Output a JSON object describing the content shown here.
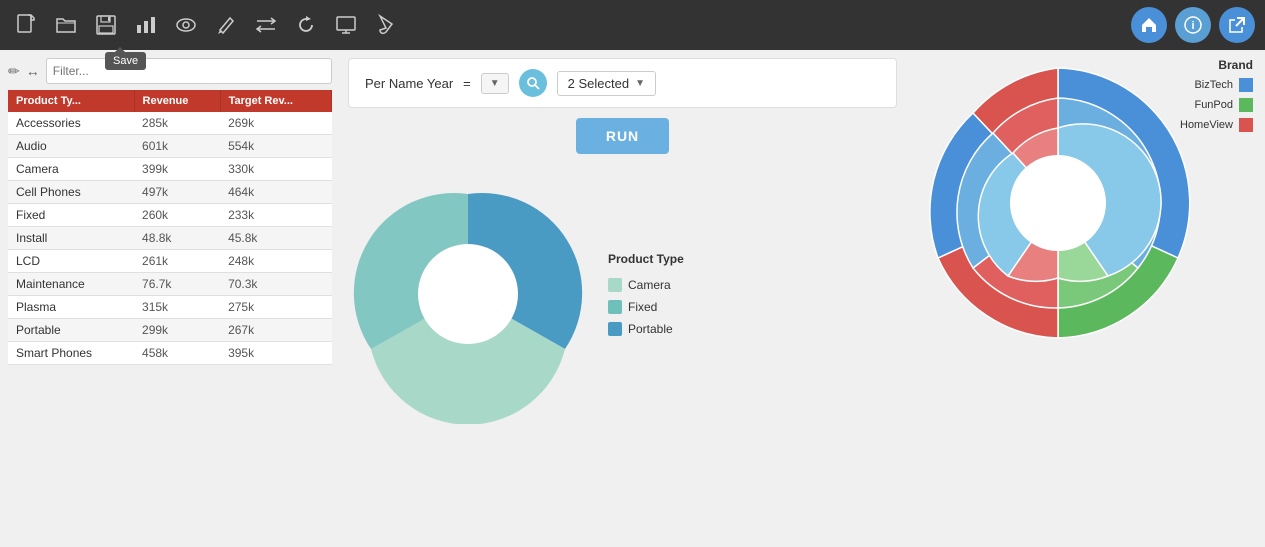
{
  "toolbar": {
    "icons": [
      {
        "name": "new-file-icon",
        "symbol": "🗋",
        "tooltip": ""
      },
      {
        "name": "open-icon",
        "symbol": "📂",
        "tooltip": ""
      },
      {
        "name": "save-icon",
        "symbol": "💾",
        "tooltip": "Save"
      },
      {
        "name": "chart-icon",
        "symbol": "📊",
        "tooltip": ""
      },
      {
        "name": "eye-icon",
        "symbol": "👁",
        "tooltip": ""
      },
      {
        "name": "edit-icon",
        "symbol": "✏",
        "tooltip": ""
      },
      {
        "name": "swap-icon",
        "symbol": "⇄",
        "tooltip": ""
      },
      {
        "name": "refresh-icon",
        "symbol": "🔄",
        "tooltip": ""
      },
      {
        "name": "monitor-icon",
        "symbol": "🖥",
        "tooltip": ""
      },
      {
        "name": "brush-icon",
        "symbol": "🖌",
        "tooltip": ""
      }
    ],
    "save_tooltip": "Save",
    "home_btn": "🏠",
    "info_btn": "ℹ",
    "export_btn": "↗"
  },
  "filter_panel": {
    "filter_placeholder": "Filter...",
    "pencil_icon": "✏",
    "arrow_icon": "↔"
  },
  "table": {
    "headers": [
      "Product Ty...",
      "Revenue",
      "Target Rev..."
    ],
    "rows": [
      [
        "Accessories",
        "285k",
        "269k"
      ],
      [
        "Audio",
        "601k",
        "554k"
      ],
      [
        "Camera",
        "399k",
        "330k"
      ],
      [
        "Cell Phones",
        "497k",
        "464k"
      ],
      [
        "Fixed",
        "260k",
        "233k"
      ],
      [
        "Install",
        "48.8k",
        "45.8k"
      ],
      [
        "LCD",
        "261k",
        "248k"
      ],
      [
        "Maintenance",
        "76.7k",
        "70.3k"
      ],
      [
        "Plasma",
        "315k",
        "275k"
      ],
      [
        "Portable",
        "299k",
        "267k"
      ],
      [
        "Smart Phones",
        "458k",
        "395k"
      ]
    ]
  },
  "filter_bar": {
    "label": "Per Name Year",
    "operator": "=",
    "selected_label": "2 Selected",
    "run_button": "RUN"
  },
  "donut_chart": {
    "legend_title": "Product Type",
    "legend_items": [
      {
        "label": "Camera",
        "color": "#a8d8c8"
      },
      {
        "label": "Fixed",
        "color": "#6fbfba"
      },
      {
        "label": "Portable",
        "color": "#4a9bc4"
      }
    ],
    "segments": [
      {
        "color": "#4a9bc4",
        "startAngle": 0,
        "endAngle": 110
      },
      {
        "color": "#a8d8c8",
        "startAngle": 110,
        "endAngle": 220
      },
      {
        "color": "#6fbfba",
        "startAngle": 220,
        "endAngle": 270
      },
      {
        "color": "#5ab0c8",
        "startAngle": 270,
        "endAngle": 360
      }
    ]
  },
  "brand_legend": {
    "title": "Brand",
    "items": [
      {
        "label": "BizTech",
        "color": "#4a90d9"
      },
      {
        "label": "FunPod",
        "color": "#5cb85c"
      },
      {
        "label": "HomeView",
        "color": "#d9534f"
      }
    ]
  }
}
